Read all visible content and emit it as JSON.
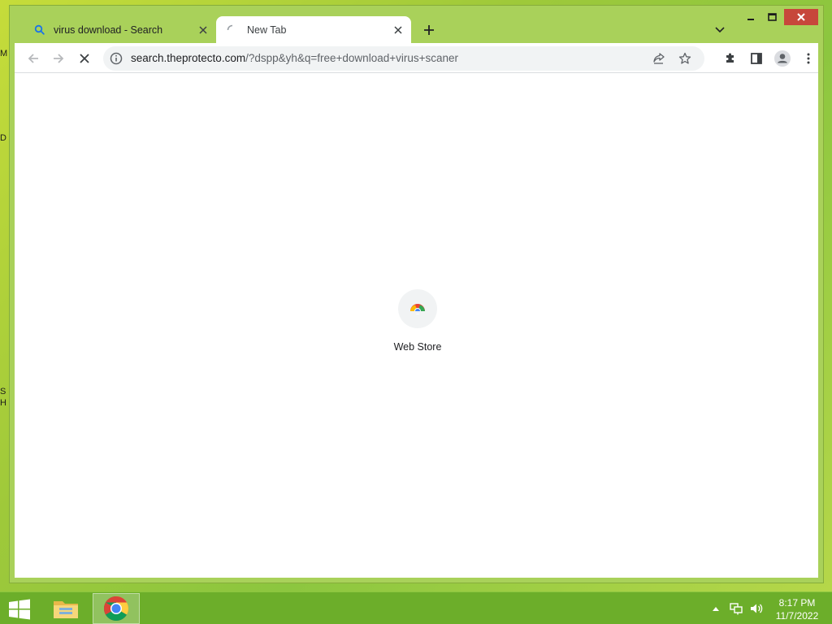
{
  "desktop": {
    "edge_glyphs": [
      "M",
      "D",
      "S",
      "H"
    ]
  },
  "browser": {
    "tabs": [
      {
        "title": "virus download - Search",
        "icon": "search-icon",
        "active": false
      },
      {
        "title": "New Tab",
        "icon": "loading-spinner-icon",
        "active": true
      }
    ],
    "toolbar": {
      "url_host": "search.theprotecto.com",
      "url_path": "/?dspp&yh&q=free+download+virus+scaner",
      "loading": true
    },
    "shortcuts": [
      {
        "label": "Web Store",
        "icon": "web-store-icon"
      }
    ],
    "colors": {
      "accent": "#a9d15a",
      "close_button": "#c7473b"
    }
  },
  "taskbar": {
    "time": "8:17 PM",
    "date": "11/7/2022",
    "apps": [
      "file-explorer",
      "chrome"
    ]
  }
}
